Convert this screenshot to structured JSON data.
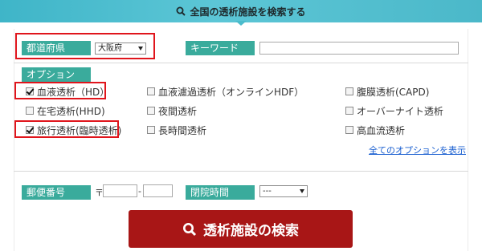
{
  "header": {
    "title": "全国の透析施設を検索する",
    "icon": "search-icon"
  },
  "prefecture": {
    "label": "都道府県",
    "selected": "大阪府"
  },
  "keyword": {
    "label": "キーワード",
    "value": ""
  },
  "options": {
    "label": "オプション",
    "items": [
      {
        "label": "血液透析（HD）",
        "checked": true
      },
      {
        "label": "血液濾過透析（オンラインHDF）",
        "checked": false
      },
      {
        "label": "腹膜透析(CAPD)",
        "checked": false
      },
      {
        "label": "在宅透析(HHD)",
        "checked": false
      },
      {
        "label": "夜間透析",
        "checked": false
      },
      {
        "label": "オーバーナイト透析",
        "checked": false
      },
      {
        "label": "旅行透析(臨時透析)",
        "checked": true
      },
      {
        "label": "長時間透析",
        "checked": false
      },
      {
        "label": "高血流透析",
        "checked": false
      }
    ],
    "show_all_link": "全てのオプションを表示"
  },
  "postal": {
    "label": "郵便番号",
    "mark": "〒",
    "separator": "-",
    "part1": "",
    "part2": ""
  },
  "closing_time": {
    "label": "閉院時間",
    "selected": "---"
  },
  "search_button": {
    "label": "透析施設の検索",
    "icon": "search-icon"
  },
  "colors": {
    "accent": "#3aab9c",
    "header": "#4bbccc",
    "button": "#a81616",
    "highlight": "#e0151c",
    "link": "#1a5fd0"
  }
}
